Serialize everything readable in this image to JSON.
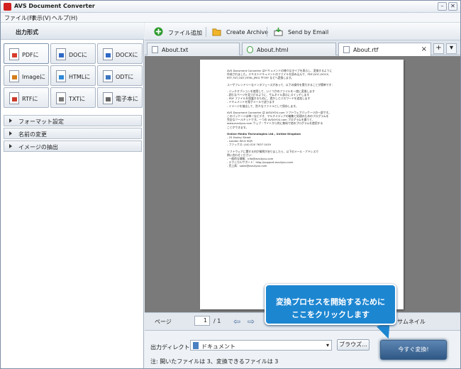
{
  "app": {
    "title": "AVS Document Converter"
  },
  "menu": [
    {
      "label": "ファイル(F)"
    },
    {
      "label": "表示(V)"
    },
    {
      "label": "ヘルプ(H)"
    }
  ],
  "left_panel": {
    "header": "出力形式",
    "formats": [
      {
        "label": "PDFに",
        "icon": "pdf-icon",
        "color": "#d83b2b"
      },
      {
        "label": "DOCに",
        "icon": "doc-icon",
        "color": "#2f69c6"
      },
      {
        "label": "DOCXに",
        "icon": "docx-icon",
        "color": "#2f69c6"
      },
      {
        "label": "Imageに",
        "icon": "image-icon",
        "color": "#d47f1a"
      },
      {
        "label": "HTMLに",
        "icon": "html-icon",
        "color": "#2f89d6"
      },
      {
        "label": "ODTに",
        "icon": "odt-icon",
        "color": "#3c75bf"
      },
      {
        "label": "RTFに",
        "icon": "rtf-icon",
        "color": "#cc3a2b"
      },
      {
        "label": "TXTに",
        "icon": "txt-icon",
        "color": "#777777"
      },
      {
        "label": "電子本に",
        "icon": "ebook-icon",
        "color": "#666666"
      }
    ],
    "sections": [
      "フォーマット設定",
      "名前の変更",
      "イメージの抽出"
    ]
  },
  "toolbar": {
    "add_file": "ファイル追加",
    "create_archive": "Create Archive",
    "send_email": "Send by Email"
  },
  "tabs": [
    {
      "label": "About.txt"
    },
    {
      "label": "About.html"
    },
    {
      "label": "About.rtf"
    }
  ],
  "document_lines": [
    "AVS Document Converter はドキュメントの様々なタイプを表示し、変換するように",
    "作成されました。テキストドキュメントのファイルを読み込んで、PDF,DOC,DOCX,",
    "RTF,TXT,ODT,HTML,JPEG やTIFF などへ変換します。",
    "",
    "ユーザフレンドリーなインタフェースがあって、以下の操作を実行することが簡単です：",
    "",
    "- バッチオプションを使用して、いくつかのファイルを一度に変換します",
    "- 読むなページを見つけるように、サムネイル表示にスイッチします",
    "- PDF ファイルを保護するために、透かしとパスワードを追加します",
    "- ドキュメントを電子メールで送ります",
    "- イメージを抽出して、別々なファイルとして保存します。",
    "",
    "AVS Document Converter は AVS4YOU.com ソフトウェアパッケージの一部です。",
    "このパッケージは単一なビデオ、マルチメディアの編集と処理のためのプログラムを",
    "完全なツールキットです。一つの AVS4YOU.com プログラムを買うと、",
    "www.avs4you.com ウェブ・サイトから的に無料で他のプログラムを使用する",
    "ことができます。",
    "",
    "Online Media Technologies Ltd., United Kingdom",
    "- 25 Harley Street",
    "- London W1G 9QR",
    "- ファックス: (44) 020 7637 0419",
    "",
    "ソフトウェアに関する何か質問がありましたら、以下のメール・アドレスで",
    "問い合わせください：",
    "- 一般的な情報：info@avs4you.com",
    "- テクニカルサポート：http://support.avs4you.com",
    "- 売上高：sales@avs4you.com"
  ],
  "navigation": {
    "page_label": "ページ",
    "current_page": "1",
    "total": "/ 1",
    "thumbnails": "サムネイル"
  },
  "output": {
    "dir_label": "出力ディレクトリ:",
    "dir_value": "ドキュメント",
    "browse": "ブラウズ...",
    "convert": "今すぐ変換!",
    "note": "注: 開いたファイルは 3、変換できるファイルは 3"
  },
  "callout": {
    "line1": "変換プロセスを開始するために",
    "line2": "ここをクリックします"
  }
}
